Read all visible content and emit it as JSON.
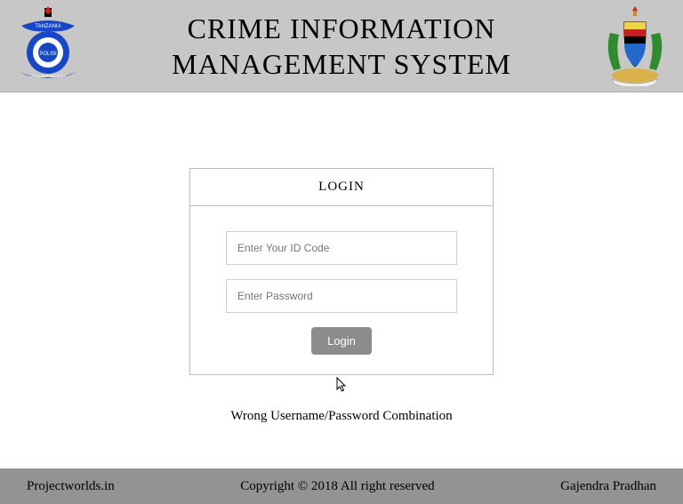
{
  "header": {
    "title_line1": "CRIME INFORMATION",
    "title_line2": "MANAGEMENT SYSTEM",
    "logo_left": "police-badge-icon",
    "logo_right": "coat-of-arms-icon"
  },
  "login": {
    "heading": "LOGIN",
    "id_placeholder": "Enter Your ID Code",
    "id_value": "",
    "password_placeholder": "Enter Password",
    "password_value": "",
    "submit_label": "Login",
    "error_message": "Wrong Username/Password Combination"
  },
  "footer": {
    "left": "Projectworlds.in",
    "center": "Copyright © 2018 All right reserved",
    "right": "Gajendra Pradhan"
  },
  "colors": {
    "header_bg": "#c7c7c7",
    "footer_bg": "#939393",
    "button_bg": "#8c8c8c"
  }
}
